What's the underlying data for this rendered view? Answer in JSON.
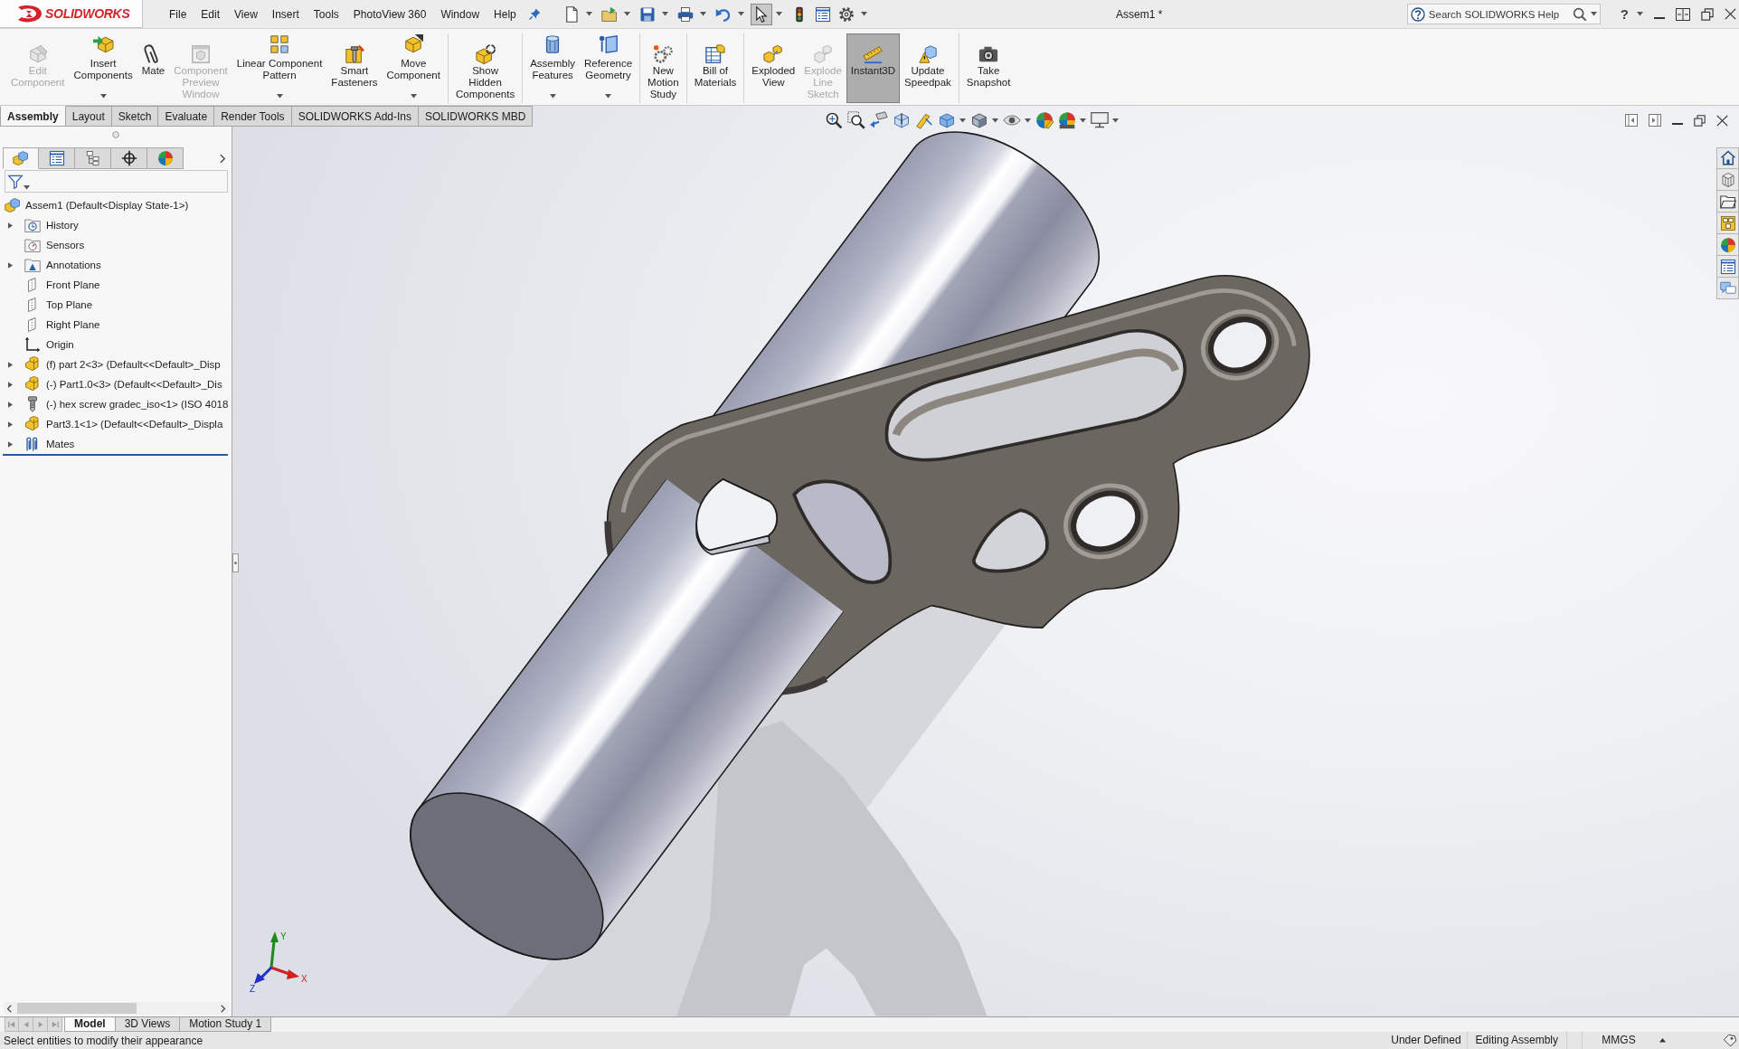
{
  "logo": {
    "text": "SOLIDWORKS"
  },
  "menu": [
    "File",
    "Edit",
    "View",
    "Insert",
    "Tools",
    "PhotoView 360",
    "Window",
    "Help"
  ],
  "quick_access": [
    {
      "kind": "new",
      "dropdown": true,
      "selected": false
    },
    {
      "kind": "open",
      "dropdown": true,
      "selected": false
    },
    {
      "kind": "save",
      "dropdown": true,
      "selected": false
    },
    {
      "kind": "print",
      "dropdown": true,
      "selected": false
    },
    {
      "kind": "undo",
      "dropdown": true,
      "selected": false
    },
    {
      "kind": "select",
      "dropdown": true,
      "selected": true
    },
    {
      "kind": "rebuild",
      "dropdown": false,
      "selected": false
    },
    {
      "kind": "properties",
      "dropdown": false,
      "selected": false
    },
    {
      "kind": "options",
      "dropdown": true,
      "selected": false
    }
  ],
  "window": {
    "title": "Assem1 *"
  },
  "help_search": {
    "placeholder": "Search SOLIDWORKS Help"
  },
  "help_button": {
    "label": "?"
  },
  "command_manager": {
    "groups": [
      {
        "buttons": [
          {
            "label": "Edit\nComponent",
            "kind": "edit",
            "disabled": true,
            "dropdown": false,
            "selected": false
          },
          {
            "label": "Insert\nComponents",
            "kind": "insert",
            "disabled": false,
            "dropdown": true,
            "selected": false
          },
          {
            "label": "Mate",
            "kind": "mate",
            "disabled": false,
            "dropdown": false,
            "selected": false
          },
          {
            "label": "Component\nPreview\nWindow",
            "kind": "preview",
            "disabled": true,
            "dropdown": false,
            "selected": false
          },
          {
            "label": "Linear Component\nPattern",
            "kind": "pattern",
            "disabled": false,
            "dropdown": true,
            "selected": false
          },
          {
            "label": "Smart\nFasteners",
            "kind": "fasteners",
            "disabled": false,
            "dropdown": false,
            "selected": false
          },
          {
            "label": "Move\nComponent",
            "kind": "move",
            "disabled": false,
            "dropdown": true,
            "selected": false
          }
        ]
      },
      {
        "buttons": [
          {
            "label": "Show\nHidden\nComponents",
            "kind": "reveal",
            "disabled": false,
            "dropdown": false,
            "selected": false
          }
        ]
      },
      {
        "buttons": [
          {
            "label": "Assembly\nFeatures",
            "kind": "features",
            "disabled": false,
            "dropdown": true,
            "selected": false
          },
          {
            "label": "Reference\nGeometry",
            "kind": "reference",
            "disabled": false,
            "dropdown": true,
            "selected": false
          }
        ]
      },
      {
        "buttons": [
          {
            "label": "New\nMotion\nStudy",
            "kind": "motion",
            "disabled": false,
            "dropdown": false,
            "selected": false
          }
        ]
      },
      {
        "buttons": [
          {
            "label": "Bill of\nMaterials",
            "kind": "bom",
            "disabled": false,
            "dropdown": false,
            "selected": false
          }
        ]
      },
      {
        "buttons": [
          {
            "label": "Exploded\nView",
            "kind": "explode",
            "disabled": false,
            "dropdown": false,
            "selected": false
          },
          {
            "label": "Explode\nLine\nSketch",
            "kind": "lines",
            "disabled": true,
            "dropdown": false,
            "selected": false
          },
          {
            "label": "Instant3D",
            "kind": "instant3d",
            "disabled": false,
            "dropdown": false,
            "selected": true
          },
          {
            "label": "Update\nSpeedpak",
            "kind": "speedpak",
            "disabled": false,
            "dropdown": false,
            "selected": false
          }
        ]
      },
      {
        "buttons": [
          {
            "label": "Take\nSnapshot",
            "kind": "snapshot",
            "disabled": false,
            "dropdown": false,
            "selected": false
          }
        ]
      }
    ]
  },
  "tabs": [
    {
      "label": "Assembly",
      "selected": true
    },
    {
      "label": "Layout",
      "selected": false
    },
    {
      "label": "Sketch",
      "selected": false
    },
    {
      "label": "Evaluate",
      "selected": false
    },
    {
      "label": "Render Tools",
      "selected": false
    },
    {
      "label": "SOLIDWORKS Add-Ins",
      "selected": false
    },
    {
      "label": "SOLIDWORKS MBD",
      "selected": false
    }
  ],
  "feature_manager": {
    "panel_tabs": [
      {
        "kind": "feature-tree",
        "selected": true
      },
      {
        "kind": "property",
        "selected": false
      },
      {
        "kind": "configuration",
        "selected": false
      },
      {
        "kind": "dimxpert",
        "selected": false
      },
      {
        "kind": "display",
        "selected": false
      }
    ],
    "tree": {
      "label": "Assem1 (Default<Display State-1>)",
      "kind": "assembly",
      "children": [
        {
          "label": "History",
          "kind": "history",
          "expandable": true
        },
        {
          "label": "Sensors",
          "kind": "sensors",
          "expandable": false
        },
        {
          "label": "Annotations",
          "kind": "annotations",
          "expandable": true
        },
        {
          "label": "Front Plane",
          "kind": "plane",
          "expandable": false
        },
        {
          "label": "Top Plane",
          "kind": "plane",
          "expandable": false
        },
        {
          "label": "Right Plane",
          "kind": "plane",
          "expandable": false
        },
        {
          "label": "Origin",
          "kind": "origin",
          "expandable": false
        },
        {
          "label": "(f) part 2<3> (Default<<Default>_Disp",
          "kind": "part",
          "expandable": true
        },
        {
          "label": "(-) Part1.0<3> (Default<<Default>_Dis",
          "kind": "part",
          "expandable": true
        },
        {
          "label": "(-) hex screw gradec_iso<1> (ISO 4018",
          "kind": "screw",
          "expandable": true
        },
        {
          "label": "Part3.1<1> (Default<<Default>_Displa",
          "kind": "part",
          "expandable": true
        },
        {
          "label": "Mates",
          "kind": "mates",
          "expandable": true
        }
      ]
    }
  },
  "graphics_area": {
    "triad": {
      "x": "X",
      "y": "Y",
      "z": "Z"
    }
  },
  "bottom_tabs": [
    {
      "label": "Model",
      "selected": true
    },
    {
      "label": "3D Views",
      "selected": false
    },
    {
      "label": "Motion Study 1",
      "selected": false
    }
  ],
  "status_bar": {
    "message": "Select entities to modify their appearance",
    "fields": [
      "Under Defined",
      "Editing Assembly",
      "MMGS"
    ]
  }
}
